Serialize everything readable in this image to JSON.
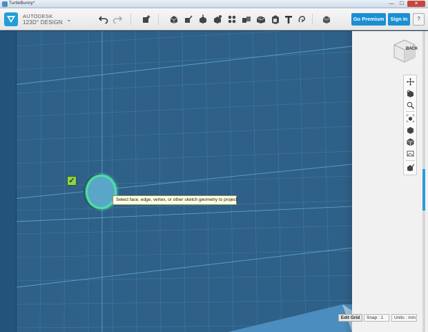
{
  "window": {
    "title": "TurtleBunny*",
    "minimize_glyph": "—",
    "maximize_glyph": "☐",
    "close_glyph": "✕"
  },
  "app": {
    "brand": "AUTODESK",
    "product": "123D° DESIGN",
    "menu_glyph": "⌄"
  },
  "toolbar": {
    "icons": [
      "undo-icon",
      "redo-icon",
      "transform-icon",
      "primitives-icon",
      "sketch-icon",
      "construct-icon",
      "modify-icon",
      "pattern-icon",
      "grouping-icon",
      "combine-icon",
      "measure-icon",
      "text-icon",
      "snap-icon",
      "material-icon"
    ],
    "premium_label": "Go Premium",
    "signin_label": "Sign In",
    "help_label": "?"
  },
  "viewcube": {
    "face_label": "BACK"
  },
  "navbar": {
    "icons": [
      "pan-icon",
      "orbit-icon",
      "zoom-icon",
      "fit-icon",
      "view-materials-icon",
      "view-outlines-icon",
      "view-hidden-icon",
      "toggle-visibility-icon"
    ]
  },
  "sketch": {
    "tooltip": "Select face, edge, vertex, or other sketch geometry to project",
    "check_glyph": "✓"
  },
  "grid": {
    "edit_label": "Edit Grid",
    "snap_label": "Snap : 1",
    "units_label": "Units : mm"
  },
  "colors": {
    "viewport_bg": "#2e6088",
    "accent_blue": "#1a8fd4",
    "sketch_highlight": "#46e3a0"
  }
}
